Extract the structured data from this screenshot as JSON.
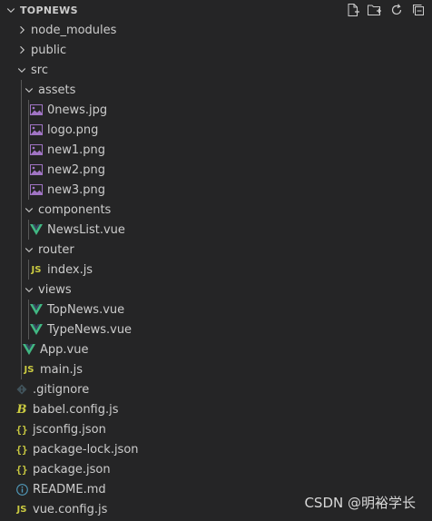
{
  "header": {
    "title": "TOPNEWS"
  },
  "watermark": "CSDN @明裕学长",
  "tree": [
    {
      "label": "node_modules",
      "depth": 0,
      "kind": "folder",
      "open": false
    },
    {
      "label": "public",
      "depth": 0,
      "kind": "folder",
      "open": false
    },
    {
      "label": "src",
      "depth": 0,
      "kind": "folder",
      "open": true
    },
    {
      "label": "assets",
      "depth": 1,
      "kind": "folder",
      "open": true
    },
    {
      "label": "0news.jpg",
      "depth": 2,
      "kind": "image"
    },
    {
      "label": "logo.png",
      "depth": 2,
      "kind": "image"
    },
    {
      "label": "new1.png",
      "depth": 2,
      "kind": "image"
    },
    {
      "label": "new2.png",
      "depth": 2,
      "kind": "image"
    },
    {
      "label": "new3.png",
      "depth": 2,
      "kind": "image"
    },
    {
      "label": "components",
      "depth": 1,
      "kind": "folder",
      "open": true
    },
    {
      "label": "NewsList.vue",
      "depth": 2,
      "kind": "vue"
    },
    {
      "label": "router",
      "depth": 1,
      "kind": "folder",
      "open": true
    },
    {
      "label": "index.js",
      "depth": 2,
      "kind": "js"
    },
    {
      "label": "views",
      "depth": 1,
      "kind": "folder",
      "open": true
    },
    {
      "label": "TopNews.vue",
      "depth": 2,
      "kind": "vue"
    },
    {
      "label": "TypeNews.vue",
      "depth": 2,
      "kind": "vue"
    },
    {
      "label": "App.vue",
      "depth": 1,
      "kind": "vue"
    },
    {
      "label": "main.js",
      "depth": 1,
      "kind": "js"
    },
    {
      "label": ".gitignore",
      "depth": 0,
      "kind": "git"
    },
    {
      "label": "babel.config.js",
      "depth": 0,
      "kind": "babel"
    },
    {
      "label": "jsconfig.json",
      "depth": 0,
      "kind": "json"
    },
    {
      "label": "package-lock.json",
      "depth": 0,
      "kind": "json"
    },
    {
      "label": "package.json",
      "depth": 0,
      "kind": "json"
    },
    {
      "label": "README.md",
      "depth": 0,
      "kind": "info"
    },
    {
      "label": "vue.config.js",
      "depth": 0,
      "kind": "js"
    }
  ],
  "icon_names": {
    "folder": "chevron-icon",
    "image": "image-file-icon",
    "vue": "vue-file-icon",
    "js": "js-file-icon",
    "git": "git-file-icon",
    "babel": "babel-file-icon",
    "json": "json-file-icon",
    "info": "info-file-icon"
  },
  "colors": {
    "vue": "#41b883",
    "js": "#cbcb41",
    "json": "#cbcb41",
    "babel": "#cbcb41",
    "image": "#a074c4",
    "git": "#41535b",
    "info": "#519aba"
  }
}
